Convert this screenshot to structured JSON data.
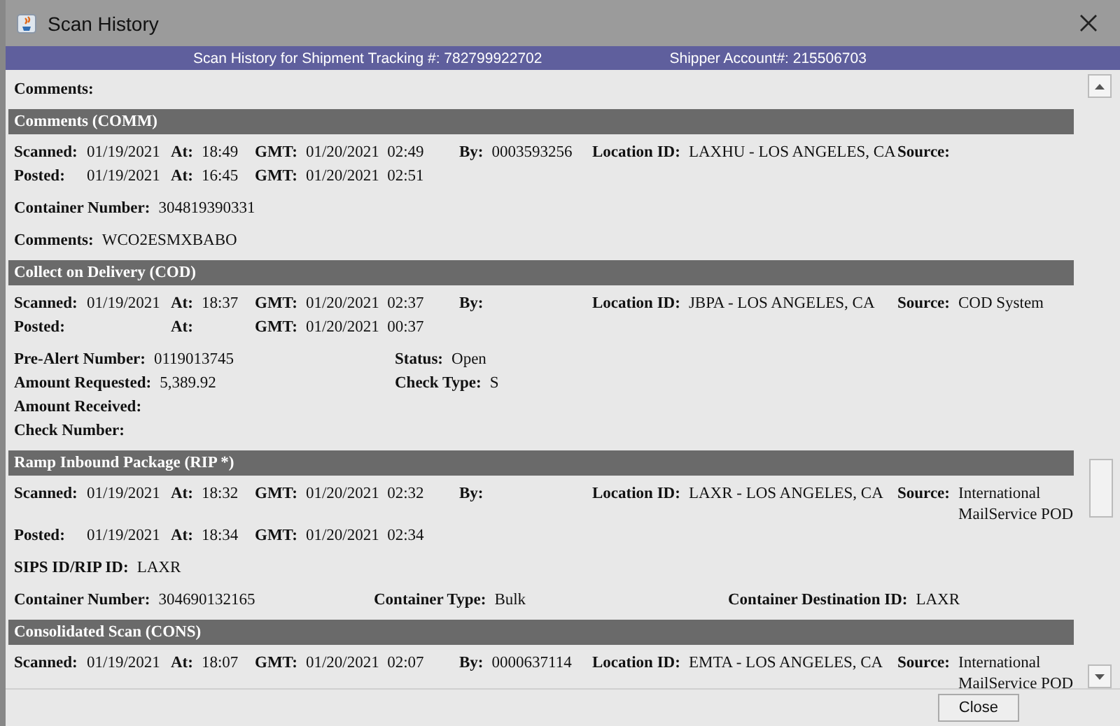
{
  "window": {
    "title": "Scan History"
  },
  "header": {
    "tracking": "Scan History for Shipment Tracking #: 782799922702",
    "account": "Shipper Account#: 215506703"
  },
  "top_line": {
    "label": "Comments:"
  },
  "sections": [
    {
      "title": "Comments (COMM)",
      "groups": [
        {
          "kind": "scan",
          "rows": [
            {
              "cells": [
                {
                  "label": "Scanned:",
                  "value": "01/19/2021"
                },
                {
                  "label": "At:",
                  "value": "18:49"
                },
                {
                  "label": "GMT:",
                  "value": "01/20/2021  02:49"
                },
                {
                  "label": "By:",
                  "value": "0003593256"
                },
                {
                  "label": "Location ID:",
                  "value": "LAXHU - LOS ANGELES, CA"
                },
                {
                  "label": "Source:"
                }
              ]
            },
            {
              "cells": [
                {
                  "label": "Posted:",
                  "value": "01/19/2021"
                },
                {
                  "label": "At:",
                  "value": "16:45"
                },
                {
                  "label": "GMT:",
                  "value": "01/20/2021  02:51"
                }
              ]
            }
          ]
        },
        {
          "kind": "single",
          "rows": [
            {
              "cells": [
                {
                  "label": "Container Number:",
                  "value": "304819390331"
                }
              ]
            }
          ]
        },
        {
          "kind": "single",
          "rows": [
            {
              "cells": [
                {
                  "label": "Comments:",
                  "value": "WCO2ESMXBABO"
                }
              ]
            }
          ]
        }
      ]
    },
    {
      "title": "Collect on Delivery (COD)",
      "groups": [
        {
          "kind": "scan",
          "rows": [
            {
              "cells": [
                {
                  "label": "Scanned:",
                  "value": "01/19/2021"
                },
                {
                  "label": "At:",
                  "value": "18:37"
                },
                {
                  "label": "GMT:",
                  "value": "01/20/2021  02:37"
                },
                {
                  "label": "By:"
                },
                {
                  "label": "Location ID:",
                  "value": "JBPA - LOS ANGELES, CA"
                },
                {
                  "label": "Source:",
                  "value": "COD System"
                }
              ]
            },
            {
              "cells": [
                {
                  "label": "Posted:"
                },
                {
                  "label": "At:"
                },
                {
                  "label": "GMT:",
                  "value": "01/20/2021  00:37"
                }
              ]
            }
          ]
        },
        {
          "kind": "pairs",
          "rows": [
            {
              "cells": [
                {
                  "label": "Pre-Alert Number:",
                  "value": "0119013745"
                },
                {
                  "label": "Status:",
                  "value": "Open"
                }
              ]
            },
            {
              "cells": [
                {
                  "label": "Amount Requested:",
                  "value": "5,389.92"
                },
                {
                  "label": "Check Type:",
                  "value": "S"
                }
              ]
            },
            {
              "cells": [
                {
                  "label": "Amount Received:"
                }
              ]
            },
            {
              "cells": [
                {
                  "label": "Check Number:"
                }
              ]
            }
          ]
        }
      ]
    },
    {
      "title": "Ramp Inbound Package (RIP *)",
      "groups": [
        {
          "kind": "scan",
          "rows": [
            {
              "cells": [
                {
                  "label": "Scanned:",
                  "value": "01/19/2021"
                },
                {
                  "label": "At:",
                  "value": "18:32"
                },
                {
                  "label": "GMT:",
                  "value": "01/20/2021  02:32"
                },
                {
                  "label": "By:"
                },
                {
                  "label": "Location ID:",
                  "value": "LAXR - LOS ANGELES, CA"
                },
                {
                  "label": "Source:",
                  "value": "International MailService POD"
                }
              ]
            },
            {
              "cells": [
                {
                  "label": "Posted:",
                  "value": "01/19/2021"
                },
                {
                  "label": "At:",
                  "value": "18:34"
                },
                {
                  "label": "GMT:",
                  "value": "01/20/2021  02:34"
                }
              ]
            }
          ]
        },
        {
          "kind": "single",
          "rows": [
            {
              "cells": [
                {
                  "label": "SIPS ID/RIP ID:",
                  "value": "LAXR"
                }
              ]
            }
          ]
        },
        {
          "kind": "triple",
          "rows": [
            {
              "cells": [
                {
                  "label": "Container Number:",
                  "value": "304690132165"
                },
                {
                  "label": "Container Type:",
                  "value": "Bulk"
                },
                {
                  "label": "Container Destination ID:",
                  "value": "LAXR"
                }
              ]
            }
          ]
        }
      ]
    },
    {
      "title": "Consolidated Scan (CONS)",
      "groups": [
        {
          "kind": "scan",
          "rows": [
            {
              "cells": [
                {
                  "label": "Scanned:",
                  "value": "01/19/2021"
                },
                {
                  "label": "At:",
                  "value": "18:07"
                },
                {
                  "label": "GMT:",
                  "value": "01/20/2021  02:07"
                },
                {
                  "label": "By:",
                  "value": "0000637114"
                },
                {
                  "label": "Location ID:",
                  "value": "EMTA - LOS ANGELES, CA"
                },
                {
                  "label": "Source:",
                  "value": "International MailService POD"
                }
              ]
            }
          ]
        }
      ]
    }
  ],
  "buttons": [
    {
      "label": "Close"
    }
  ]
}
